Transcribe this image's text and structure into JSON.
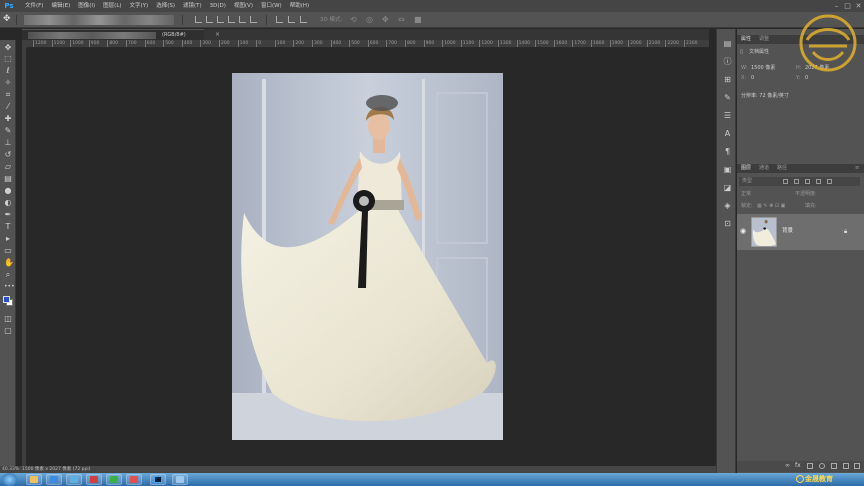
{
  "app": {
    "logo": "Ps"
  },
  "menu": [
    "文件(F)",
    "编辑(E)",
    "图像(I)",
    "图层(L)",
    "文字(Y)",
    "选择(S)",
    "滤镜(T)",
    "3D(D)",
    "视图(V)",
    "窗口(W)",
    "帮助(H)"
  ],
  "window_controls": [
    "–",
    "□",
    "✕"
  ],
  "options": {
    "mode_3d_label": "3D 模式:"
  },
  "document": {
    "tab_title": "(RGB/8#)",
    "close": "×"
  },
  "ruler": {
    "ticks": [
      "1200",
      "1100",
      "1000",
      "900",
      "800",
      "700",
      "600",
      "500",
      "400",
      "300",
      "200",
      "100",
      "0",
      "100",
      "200",
      "300",
      "400",
      "500",
      "600",
      "700",
      "800",
      "900",
      "1000",
      "1100",
      "1200",
      "1300",
      "1400",
      "1500",
      "1600",
      "1700",
      "1800",
      "1900",
      "2000",
      "2100",
      "2200",
      "2300"
    ]
  },
  "status": {
    "zoom": "40.33%",
    "doc_info": "1500 像素 x 2027 像素 (72 ppi)"
  },
  "properties": {
    "tabs": [
      "属性",
      "调整"
    ],
    "section": "文档属性",
    "width_label": "W:",
    "width_value": "1500 像素",
    "height_label": "H:",
    "height_value": "2027 像素",
    "x_label": "X:",
    "x_value": "0",
    "y_label": "Y:",
    "y_value": "0",
    "resolution": "分辨率: 72 像素/英寸"
  },
  "layers": {
    "tabs": [
      "图层",
      "通道",
      "路径"
    ],
    "kind_filter": "类型",
    "blend_mode": "正常",
    "opacity_label": "不透明度:",
    "lock_label": "锁定:",
    "fill_label": "填充:",
    "items": [
      {
        "name": "背景",
        "visible": true,
        "locked": true
      }
    ]
  },
  "taskbar": {
    "brand": "金晟教育"
  },
  "colors": {
    "foreground": "#2a4fd1",
    "background": "#ffffff",
    "accent": "#31a8ff"
  }
}
